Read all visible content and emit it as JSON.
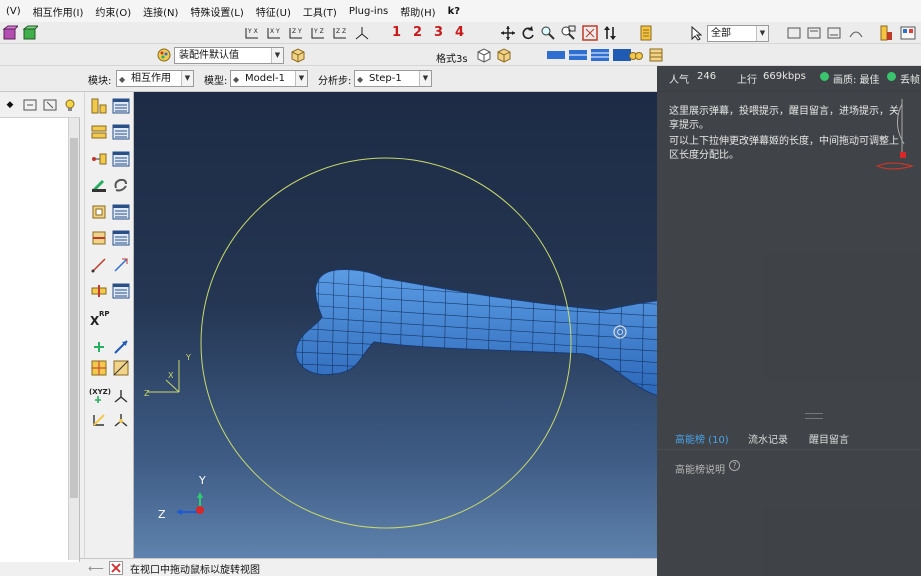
{
  "menubar": {
    "items": [
      "(V)",
      "相互作用(I)",
      "约束(O)",
      "连接(N)",
      "特殊设置(L)",
      "特征(U)",
      "工具(T)",
      "Plug-ins",
      "帮助(H)",
      "k?"
    ]
  },
  "toolbar": {
    "dof_labels": [
      "1",
      "2",
      "3",
      "4"
    ],
    "csys_labels": [
      "Y X",
      "Z Y",
      "X Z",
      "Z Z",
      "Z"
    ],
    "assembly_combo": "装配件默认值",
    "render_style_label": "格式",
    "render_value": "3",
    "render_suffix": "s",
    "selection_filter": "全部"
  },
  "context": {
    "module_label": "模块:",
    "module_value": "相互作用",
    "model_label": "模型:",
    "model_value": "Model-1",
    "step_label": "分析步:",
    "step_value": "Step-1"
  },
  "viewport": {
    "mini_triad": {
      "y": "Y",
      "x": "X",
      "z": "Z"
    },
    "triad": {
      "y": "Y",
      "z": "Z"
    },
    "rp_label": "RP"
  },
  "prompt": {
    "text": "在视口中拖动鼠标以旋转视图"
  },
  "overlay": {
    "popularity_label": "人气",
    "popularity_value": "246",
    "upload_label": "上行",
    "upload_value": "669kbps",
    "quality_label": "画质: 最佳",
    "loss_label": "丢帧",
    "description_lines": [
      "这里展示弹幕，投喂提示，醒目留言，进场提示，关",
      "享提示。",
      "可以上下拉伸更改弹幕姬的长度，中间拖动可调整上",
      "区长度分配比。"
    ],
    "tabs": [
      "高能榜 (10)",
      "流水记录",
      "醒目留言"
    ],
    "leaderboard_title": "高能榜说明",
    "help_glyph": "?"
  },
  "colors": {
    "bone": "#3a7fd0",
    "bone_mesh": "#0d2a55",
    "circle": "#c9d96b",
    "tab_active": "#4aa3e8",
    "dot_green": "#39c46e"
  }
}
